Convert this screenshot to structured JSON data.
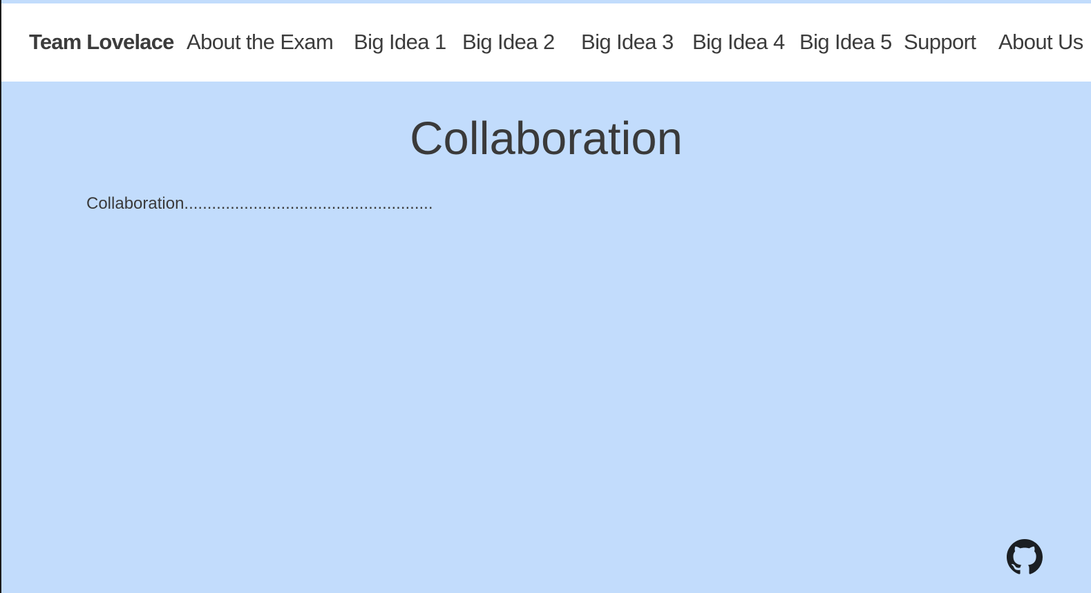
{
  "navbar": {
    "brand": "Team Lovelace",
    "items": [
      {
        "label": "About the Exam"
      },
      {
        "label": "Big Idea 1"
      },
      {
        "label": "Big Idea 2"
      },
      {
        "label": "Big Idea 3"
      },
      {
        "label": "Big Idea 4"
      },
      {
        "label": "Big Idea 5"
      },
      {
        "label": "Support"
      },
      {
        "label": "About Us"
      }
    ]
  },
  "main": {
    "title": "Collaboration",
    "body": "Collaboration......................................................"
  },
  "footer": {
    "icon": "github-icon"
  },
  "colors": {
    "background": "#c2dcfc",
    "navbar": "#ffffff",
    "text": "#3a3a3a"
  }
}
